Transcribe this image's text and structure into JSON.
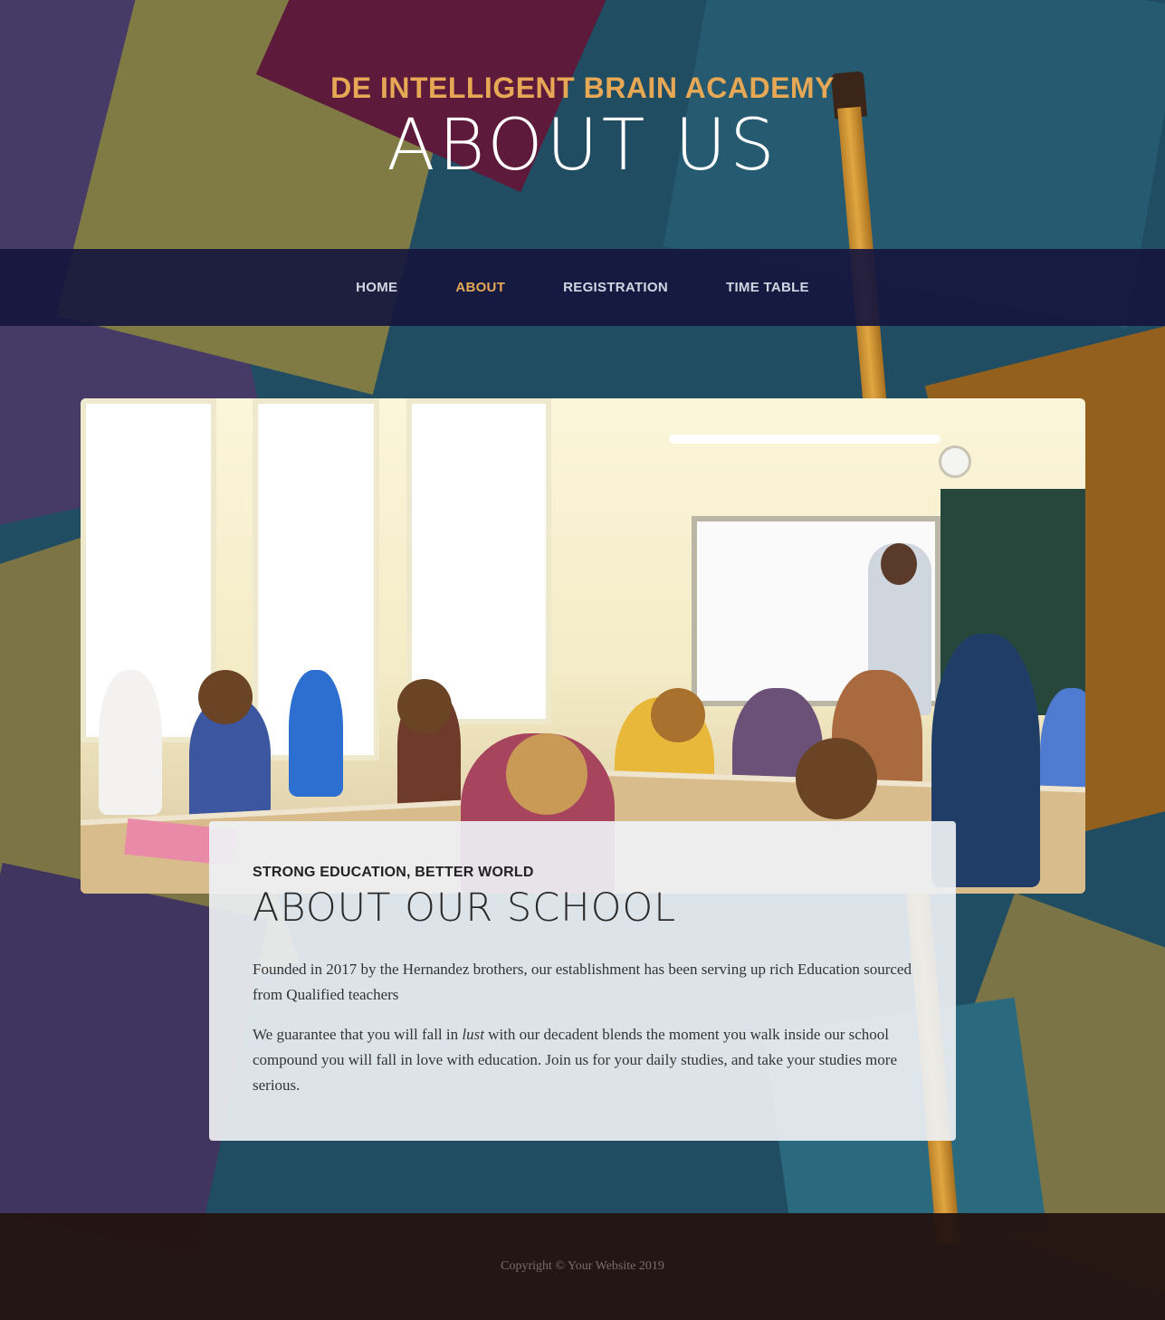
{
  "header": {
    "brand": "DE INTELLIGENT BRAIN ACADEMY",
    "page_title": "ABOUT US"
  },
  "nav": {
    "items": [
      {
        "label": "HOME",
        "active": false
      },
      {
        "label": "ABOUT",
        "active": true
      },
      {
        "label": "REGISTRATION",
        "active": false
      },
      {
        "label": "TIME TABLE",
        "active": false
      }
    ]
  },
  "about": {
    "kicker": "STRONG EDUCATION, BETTER WORLD",
    "title": "ABOUT OUR SCHOOL",
    "paragraph1": "Founded in 2017 by the Hernandez brothers, our establishment has been serving up rich Education sourced from Qualified teachers",
    "paragraph2_before": "We guarantee that you will fall in ",
    "paragraph2_emphasis": "lust",
    "paragraph2_after": " with our decadent blends the moment you walk inside our school compound you will fall in love with education. Join us for your daily studies, and take your studies more serious."
  },
  "footer": {
    "copyright": "Copyright © Your Website 2019"
  },
  "colors": {
    "accent": "#e7a855",
    "nav_bg": "#16163e",
    "footer_bg": "#231411"
  }
}
